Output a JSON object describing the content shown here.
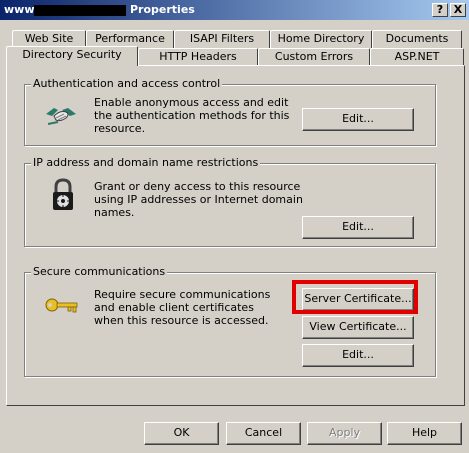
{
  "window": {
    "title_prefix": "www",
    "title": "Properties",
    "help_btn": "?",
    "close_btn": "X"
  },
  "tabs_back": [
    "Web Site",
    "Performance",
    "ISAPI Filters",
    "Home Directory",
    "Documents"
  ],
  "tabs_front": [
    "Directory Security",
    "HTTP Headers",
    "Custom Errors",
    "ASP.NET"
  ],
  "auth": {
    "title": "Authentication and access control",
    "desc": "Enable anonymous access and edit the authentication methods for this resource.",
    "edit": "Edit..."
  },
  "ipdomain": {
    "title": "IP address and domain name restrictions",
    "desc": "Grant or deny access to this resource using IP addresses or Internet domain names.",
    "edit": "Edit..."
  },
  "secure": {
    "title": "Secure communications",
    "desc": "Require secure communications and enable client certificates when this resource is accessed.",
    "server_cert": "Server Certificate...",
    "view_cert": "View Certificate...",
    "edit": "Edit..."
  },
  "footer": {
    "ok": "OK",
    "cancel": "Cancel",
    "apply": "Apply",
    "help": "Help"
  },
  "icons": {
    "auth": "handshake-icon",
    "ip": "padlock-icon",
    "secure": "key-icon"
  },
  "colors": {
    "titlebar_start": "#0a246a",
    "titlebar_end": "#a6caf0",
    "face": "#d4d0c8",
    "highlight": "#e00000"
  }
}
